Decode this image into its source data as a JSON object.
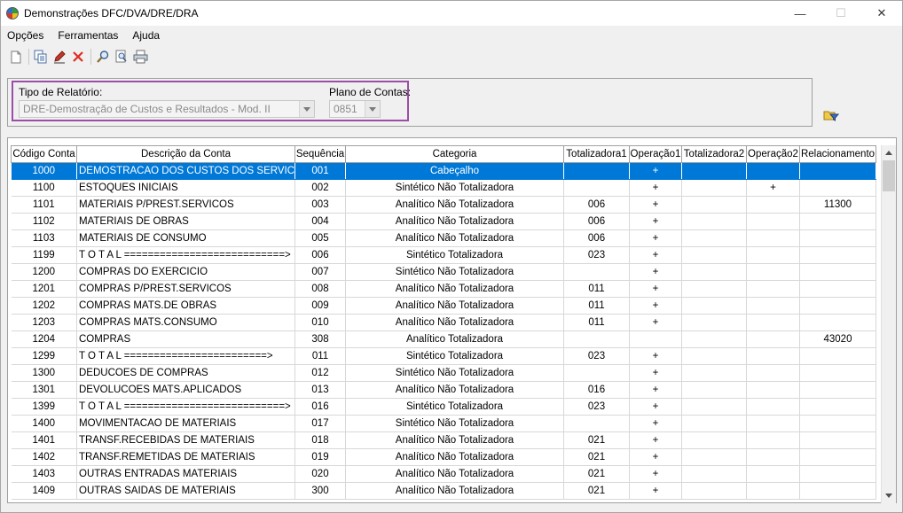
{
  "window": {
    "title": "Demonstrações DFC/DVA/DRE/DRA",
    "minimize": "—",
    "maximize": "☐",
    "close": "✕"
  },
  "menu": {
    "opcoes": "Opções",
    "ferramentas": "Ferramentas",
    "ajuda": "Ajuda"
  },
  "toolbar": {
    "icons": [
      "new-icon",
      "copy-icon",
      "edit-icon",
      "delete-icon",
      "search-icon",
      "preview-icon",
      "print-icon"
    ]
  },
  "filter": {
    "tipo_label": "Tipo de Relatório:",
    "tipo_value": "DRE-Demostração de Custos e Resultados - Mod. II",
    "plano_label": "Plano de Contas:",
    "plano_value": "0851"
  },
  "grid": {
    "columns": [
      "Código Conta",
      "Descrição da Conta",
      "Sequência",
      "Categoria",
      "Totalizadora1",
      "Operação1",
      "Totalizadora2",
      "Operação2",
      "Relacionamento"
    ],
    "rows": [
      [
        "1000",
        "DEMOSTRACAO DOS CUSTOS DOS SERVICOS",
        "001",
        "Cabeçalho",
        "",
        "+",
        "",
        "",
        ""
      ],
      [
        "1100",
        "ESTOQUES INICIAIS",
        "002",
        "Sintético Não Totalizadora",
        "",
        "+",
        "",
        "+",
        ""
      ],
      [
        "1101",
        "MATERIAIS P/PREST.SERVICOS",
        "003",
        "Analítico Não Totalizadora",
        "006",
        "+",
        "",
        "",
        "11300"
      ],
      [
        "1102",
        "MATERIAIS DE OBRAS",
        "004",
        "Analítico Não Totalizadora",
        "006",
        "+",
        "",
        "",
        ""
      ],
      [
        "1103",
        "MATERIAIS DE CONSUMO",
        "005",
        "Analítico Não Totalizadora",
        "006",
        "+",
        "",
        "",
        ""
      ],
      [
        "1199",
        "T O T A L ===========================>",
        "006",
        "Sintético Totalizadora",
        "023",
        "+",
        "",
        "",
        ""
      ],
      [
        "1200",
        "COMPRAS DO EXERCICIO",
        "007",
        "Sintético Não Totalizadora",
        "",
        "+",
        "",
        "",
        ""
      ],
      [
        "1201",
        "COMPRAS P/PREST.SERVICOS",
        "008",
        "Analítico Não Totalizadora",
        "011",
        "+",
        "",
        "",
        ""
      ],
      [
        "1202",
        "COMPRAS MATS.DE OBRAS",
        "009",
        "Analítico Não Totalizadora",
        "011",
        "+",
        "",
        "",
        ""
      ],
      [
        "1203",
        "COMPRAS MATS.CONSUMO",
        "010",
        "Analítico Não Totalizadora",
        "011",
        "+",
        "",
        "",
        ""
      ],
      [
        "1204",
        "COMPRAS",
        "308",
        "Analítico Totalizadora",
        "",
        "",
        "",
        "",
        "43020"
      ],
      [
        "1299",
        "T O T A L ========================>",
        "011",
        "Sintético Totalizadora",
        "023",
        "+",
        "",
        "",
        ""
      ],
      [
        "1300",
        "DEDUCOES DE COMPRAS",
        "012",
        "Sintético Não Totalizadora",
        "",
        "+",
        "",
        "",
        ""
      ],
      [
        "1301",
        "DEVOLUCOES MATS.APLICADOS",
        "013",
        "Analítico Não Totalizadora",
        "016",
        "+",
        "",
        "",
        ""
      ],
      [
        "1399",
        "T O T A L ===========================>",
        "016",
        "Sintético Totalizadora",
        "023",
        "+",
        "",
        "",
        ""
      ],
      [
        "1400",
        "MOVIMENTACAO DE MATERIAIS",
        "017",
        "Sintético Não Totalizadora",
        "",
        "+",
        "",
        "",
        ""
      ],
      [
        "1401",
        "TRANSF.RECEBIDAS DE MATERIAIS",
        "018",
        "Analítico Não Totalizadora",
        "021",
        "+",
        "",
        "",
        ""
      ],
      [
        "1402",
        "TRANSF.REMETIDAS DE MATERIAIS",
        "019",
        "Analítico Não Totalizadora",
        "021",
        "+",
        "",
        "",
        ""
      ],
      [
        "1403",
        "OUTRAS ENTRADAS MATERIAIS",
        "020",
        "Analítico Não Totalizadora",
        "021",
        "+",
        "",
        "",
        ""
      ],
      [
        "1409",
        "OUTRAS SAIDAS DE MATERIAIS",
        "300",
        "Analítico Não Totalizadora",
        "021",
        "+",
        "",
        "",
        ""
      ]
    ]
  }
}
